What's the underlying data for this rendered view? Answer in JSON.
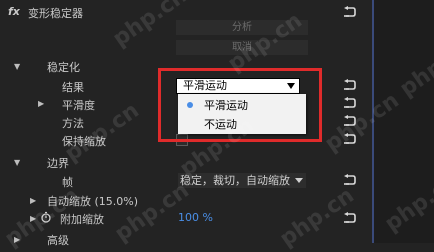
{
  "effect": {
    "fx_label": "fx",
    "title": "变形稳定器"
  },
  "buttons": {
    "analyze": "分析",
    "cancel": "取消"
  },
  "stabilization": {
    "section_label": "稳定化",
    "result_label": "结果",
    "result_value": "平滑运动",
    "options": [
      "平滑运动",
      "不运动"
    ],
    "smoothness_label": "平滑度",
    "method_label": "方法",
    "preserve_scale_label": "保持缩放"
  },
  "border": {
    "section_label": "边界",
    "frame_label": "帧",
    "frame_value": "稳定，裁切，自动缩放",
    "auto_scale_label": "自动缩放 (15.0%)",
    "additional_scale_label": "附加缩放",
    "additional_scale_value": "100 %"
  },
  "advanced": {
    "section_label": "高级"
  },
  "colors": {
    "accent_blue": "#4a8ee6",
    "highlight_red": "#e02b2b"
  },
  "watermark": "php.cn"
}
